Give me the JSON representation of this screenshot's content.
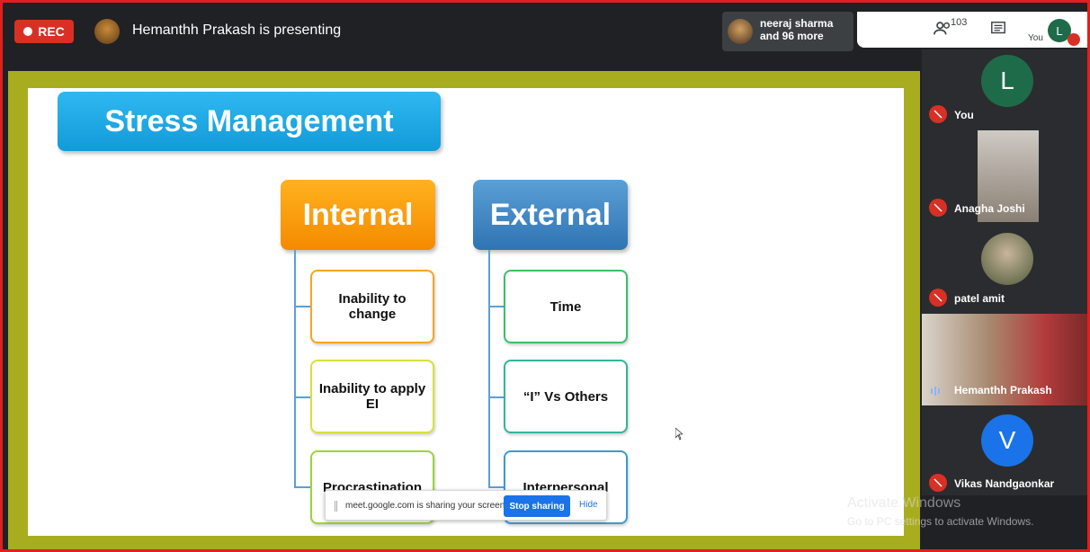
{
  "topbar": {
    "rec_label": "REC",
    "presenting_text": "Hemanthh Prakash is presenting",
    "viewers_text": [
      "neeraj sharma",
      "and 96 more"
    ],
    "participant_count": "103",
    "you_label": "You",
    "you_initial": "L"
  },
  "slide": {
    "title": "Stress Management",
    "internal": {
      "label": "Internal",
      "items": [
        "Inability to change",
        "Inability to apply EI",
        "Procrastination"
      ]
    },
    "external": {
      "label": "External",
      "items": [
        "Time",
        "“I” Vs Others",
        "Interpersonal"
      ]
    }
  },
  "share_bar": {
    "message": "meet.google.com is sharing your screen.",
    "stop_label": "Stop sharing",
    "hide_label": "Hide"
  },
  "participants": [
    {
      "name": "You",
      "initial": "L",
      "color": "#1e6b4a"
    },
    {
      "name": "Anagha Joshi"
    },
    {
      "name": "patel amit"
    },
    {
      "name": "Hemanthh Prakash"
    },
    {
      "name": "Vikas Nandgaonkar",
      "initial": "V",
      "color": "#1a73e8"
    }
  ],
  "watermark": {
    "title": "Activate Windows",
    "subtitle": "Go to PC settings to activate Windows."
  },
  "colors": {
    "rec_red": "#d93025",
    "internal_orange": "#f58a00",
    "external_blue": "#2f74b3",
    "title_blue": "#139ad9",
    "screen_border": "#a8ad1f"
  }
}
